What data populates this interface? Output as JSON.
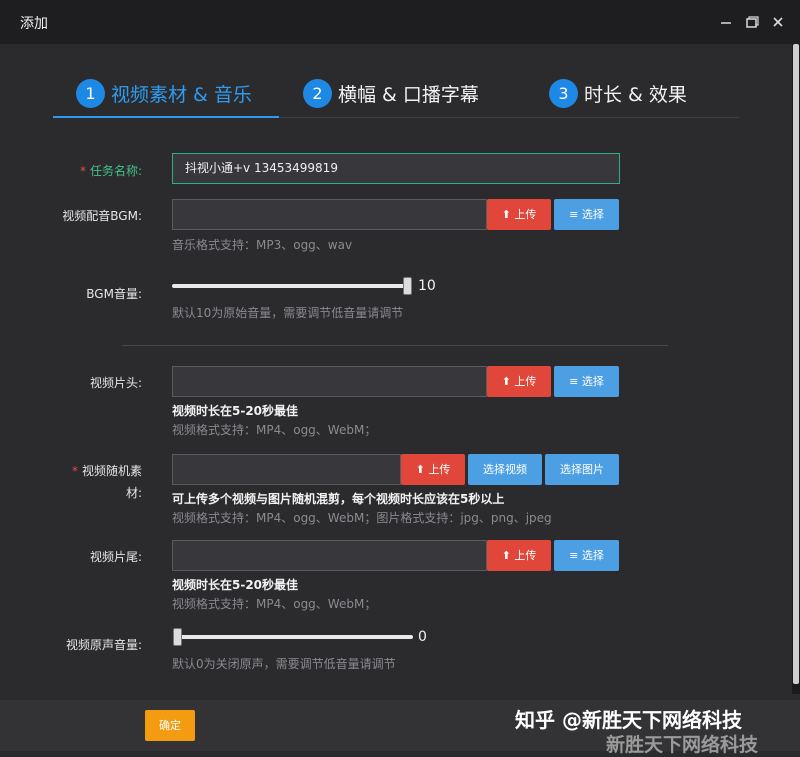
{
  "window": {
    "title": "添加",
    "minimize_icon": "minimize-icon",
    "restore_icon": "restore-icon",
    "close_icon": "close-icon"
  },
  "steps": [
    {
      "number": "1",
      "label": "视频素材 & 音乐",
      "active": true
    },
    {
      "number": "2",
      "label": "横幅 & 口播字幕",
      "active": false
    },
    {
      "number": "3",
      "label": "时长 & 效果",
      "active": false
    }
  ],
  "form": {
    "task_name": {
      "label": "任务名称:",
      "required": true,
      "value": "抖视小通+v  13453499819"
    },
    "bgm": {
      "label": "视频配音BGM:",
      "value": "",
      "upload": "上传",
      "select": "选择",
      "hint": "音乐格式支持：MP3、ogg、wav"
    },
    "bgm_volume": {
      "label": "BGM音量:",
      "value": "10",
      "level_percent": 100,
      "hint": "默认10为原始音量，需要调节低音量请调节"
    },
    "intro": {
      "label": "视频片头:",
      "value": "",
      "upload": "上传",
      "select": "选择",
      "note": "视频时长在5-20秒最佳",
      "hint": "视频格式支持：MP4、ogg、WebM；"
    },
    "random_material": {
      "label_line1": "视频随机素",
      "label_line2": "材:",
      "required": true,
      "value": "",
      "upload": "上传",
      "select_video": "选择视频",
      "select_image": "选择图片",
      "note": "可上传多个视频与图片随机混剪，每个视频时长应该在5秒以上",
      "hint": "视频格式支持：MP4、ogg、WebM；图片格式支持：jpg、png、jpeg"
    },
    "outro": {
      "label": "视频片尾:",
      "value": "",
      "upload": "上传",
      "select": "选择",
      "note": "视频时长在5-20秒最佳",
      "hint": "视频格式支持：MP4、ogg、WebM；"
    },
    "original_volume": {
      "label": "视频原声音量:",
      "value": "0",
      "level_percent": 0,
      "hint": "默认0为关闭原声，需要调节低音量请调节"
    }
  },
  "footer": {
    "confirm": "确定",
    "watermark": "知乎 @新胜天下网络科技",
    "watermark2": "新胜天下网络科技"
  },
  "colors": {
    "accent": "#2e9bf0",
    "upload_red": "#e0473a",
    "select_blue": "#4d9fe4",
    "confirm_orange": "#f39c12",
    "focus_green": "#2fae86"
  }
}
